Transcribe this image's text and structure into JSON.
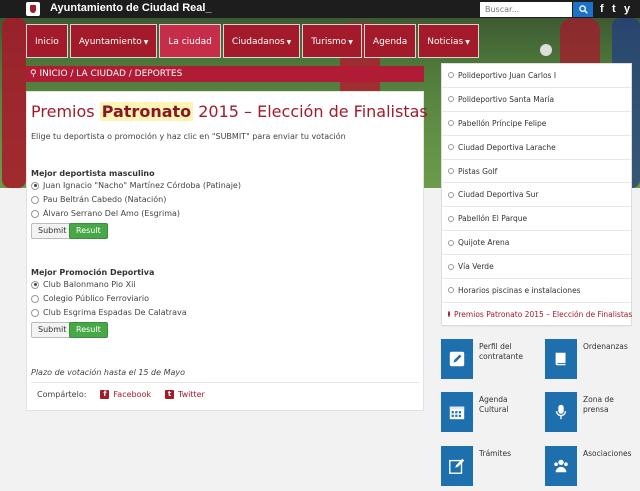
{
  "header": {
    "site_title": "Ayuntamiento de Ciudad Real_",
    "search_placeholder": "Buscar...",
    "social": [
      "f",
      "t",
      "y"
    ]
  },
  "menu": [
    {
      "label": "Inicio",
      "caret": false
    },
    {
      "label": "Ayuntamiento",
      "caret": true
    },
    {
      "label": "La ciudad",
      "caret": false,
      "active": true
    },
    {
      "label": "Ciudadanos",
      "caret": true
    },
    {
      "label": "Turismo",
      "caret": true
    },
    {
      "label": "Agenda",
      "caret": false
    },
    {
      "label": "Noticias",
      "caret": true
    }
  ],
  "breadcrumb": "INICIO / LA CIUDAD / DEPORTES",
  "main": {
    "title_prefix": "Premios ",
    "title_highlight": "Patronato",
    "title_suffix": " 2015 – Elección de Finalistas",
    "intro": "Elige tu deportista o promoción y haz clic en \"SUBMIT\" para enviar tu votación",
    "poll1": {
      "title": "Mejor deportista masculino",
      "options": [
        "Juan Ignacio \"Nacho\" Martínez Córdoba (Patinaje)",
        "Pau Beltrán Cabedo (Natación)",
        "Álvaro Serrano Del Amo (Esgrima)"
      ],
      "selected": 0
    },
    "poll2": {
      "title": "Mejor Promoción Deportiva",
      "options": [
        "Club Balonmano Pio Xii",
        "Colegio Público Ferroviario",
        "Club Esgrima Espadas De Calatrava"
      ],
      "selected": 0
    },
    "submit_label": "Submit",
    "result_label": "Result",
    "deadline": "Plazo de votación hasta el 15 de Mayo",
    "share_label": "Compártelo:",
    "share_facebook": "Facebook",
    "share_twitter": "Twitter"
  },
  "sidebar": [
    "Polideportivo Juan Carlos I",
    "Polideportivo Santa María",
    "Pabellón Príncipe Felipe",
    "Ciudad Deportiva Larache",
    "Pistas Golf",
    "Ciudad Deportiva Sur",
    "Pabellón El Parque",
    "Quijote Arena",
    "Vía Verde",
    "Horarios piscinas e instalaciones",
    "Premios Patronato 2015 – Elección de Finalistas"
  ],
  "tiles": [
    {
      "label": "Perfil del contratante",
      "icon": "pen-square-icon"
    },
    {
      "label": "Ordenanzas",
      "icon": "book-icon"
    },
    {
      "label": "Agenda Cultural",
      "icon": "calendar-icon"
    },
    {
      "label": "Zona de prensa",
      "icon": "microphone-icon"
    },
    {
      "label": "Trámites",
      "icon": "edit-icon"
    },
    {
      "label": "Asociaciones",
      "icon": "users-icon"
    }
  ],
  "colors": {
    "brand": "#a31a2b",
    "tile": "#1e6fad",
    "result": "#48a848"
  }
}
